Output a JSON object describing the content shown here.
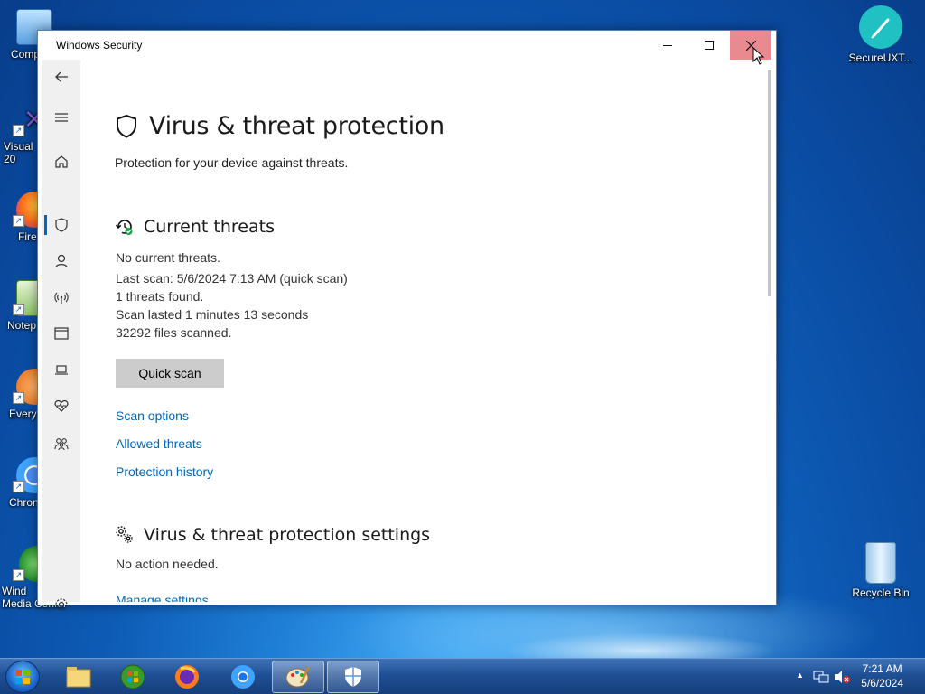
{
  "desktop": {
    "icons": [
      {
        "label": "Comp",
        "name": "desktop-icon-computer"
      },
      {
        "label": "Visual\n20",
        "name": "desktop-icon-visual-studio"
      },
      {
        "label": "Fire",
        "name": "desktop-icon-firefox"
      },
      {
        "label": "Notep",
        "name": "desktop-icon-notepad"
      },
      {
        "label": "Every",
        "name": "desktop-icon-everything"
      },
      {
        "label": "Chron",
        "name": "desktop-icon-chrome"
      },
      {
        "label": "Wind\nMedia Center",
        "name": "desktop-icon-media-center"
      }
    ],
    "secureuxt_label": "SecureUXT...",
    "recycle_label": "Recycle Bin"
  },
  "window": {
    "title": "Windows Security",
    "page_title": "Virus & threat protection",
    "subtitle": "Protection for your device against threats.",
    "current_threats": {
      "heading": "Current threats",
      "lines": [
        "No current threats.",
        "Last scan: 5/6/2024 7:13 AM (quick scan)",
        "1 threats found.",
        "Scan lasted 1 minutes 13 seconds",
        "32292 files scanned."
      ],
      "quick_scan_label": "Quick scan",
      "links": [
        "Scan options",
        "Allowed threats",
        "Protection history"
      ]
    },
    "settings": {
      "heading": "Virus & threat protection settings",
      "status": "No action needed.",
      "link": "Manage settings"
    }
  },
  "taskbar": {
    "time": "7:21 AM",
    "date": "5/6/2024"
  },
  "colors": {
    "accent": "#0067b8",
    "close_hover": "#e88a8f",
    "nav_bg": "#f0f0f0"
  }
}
